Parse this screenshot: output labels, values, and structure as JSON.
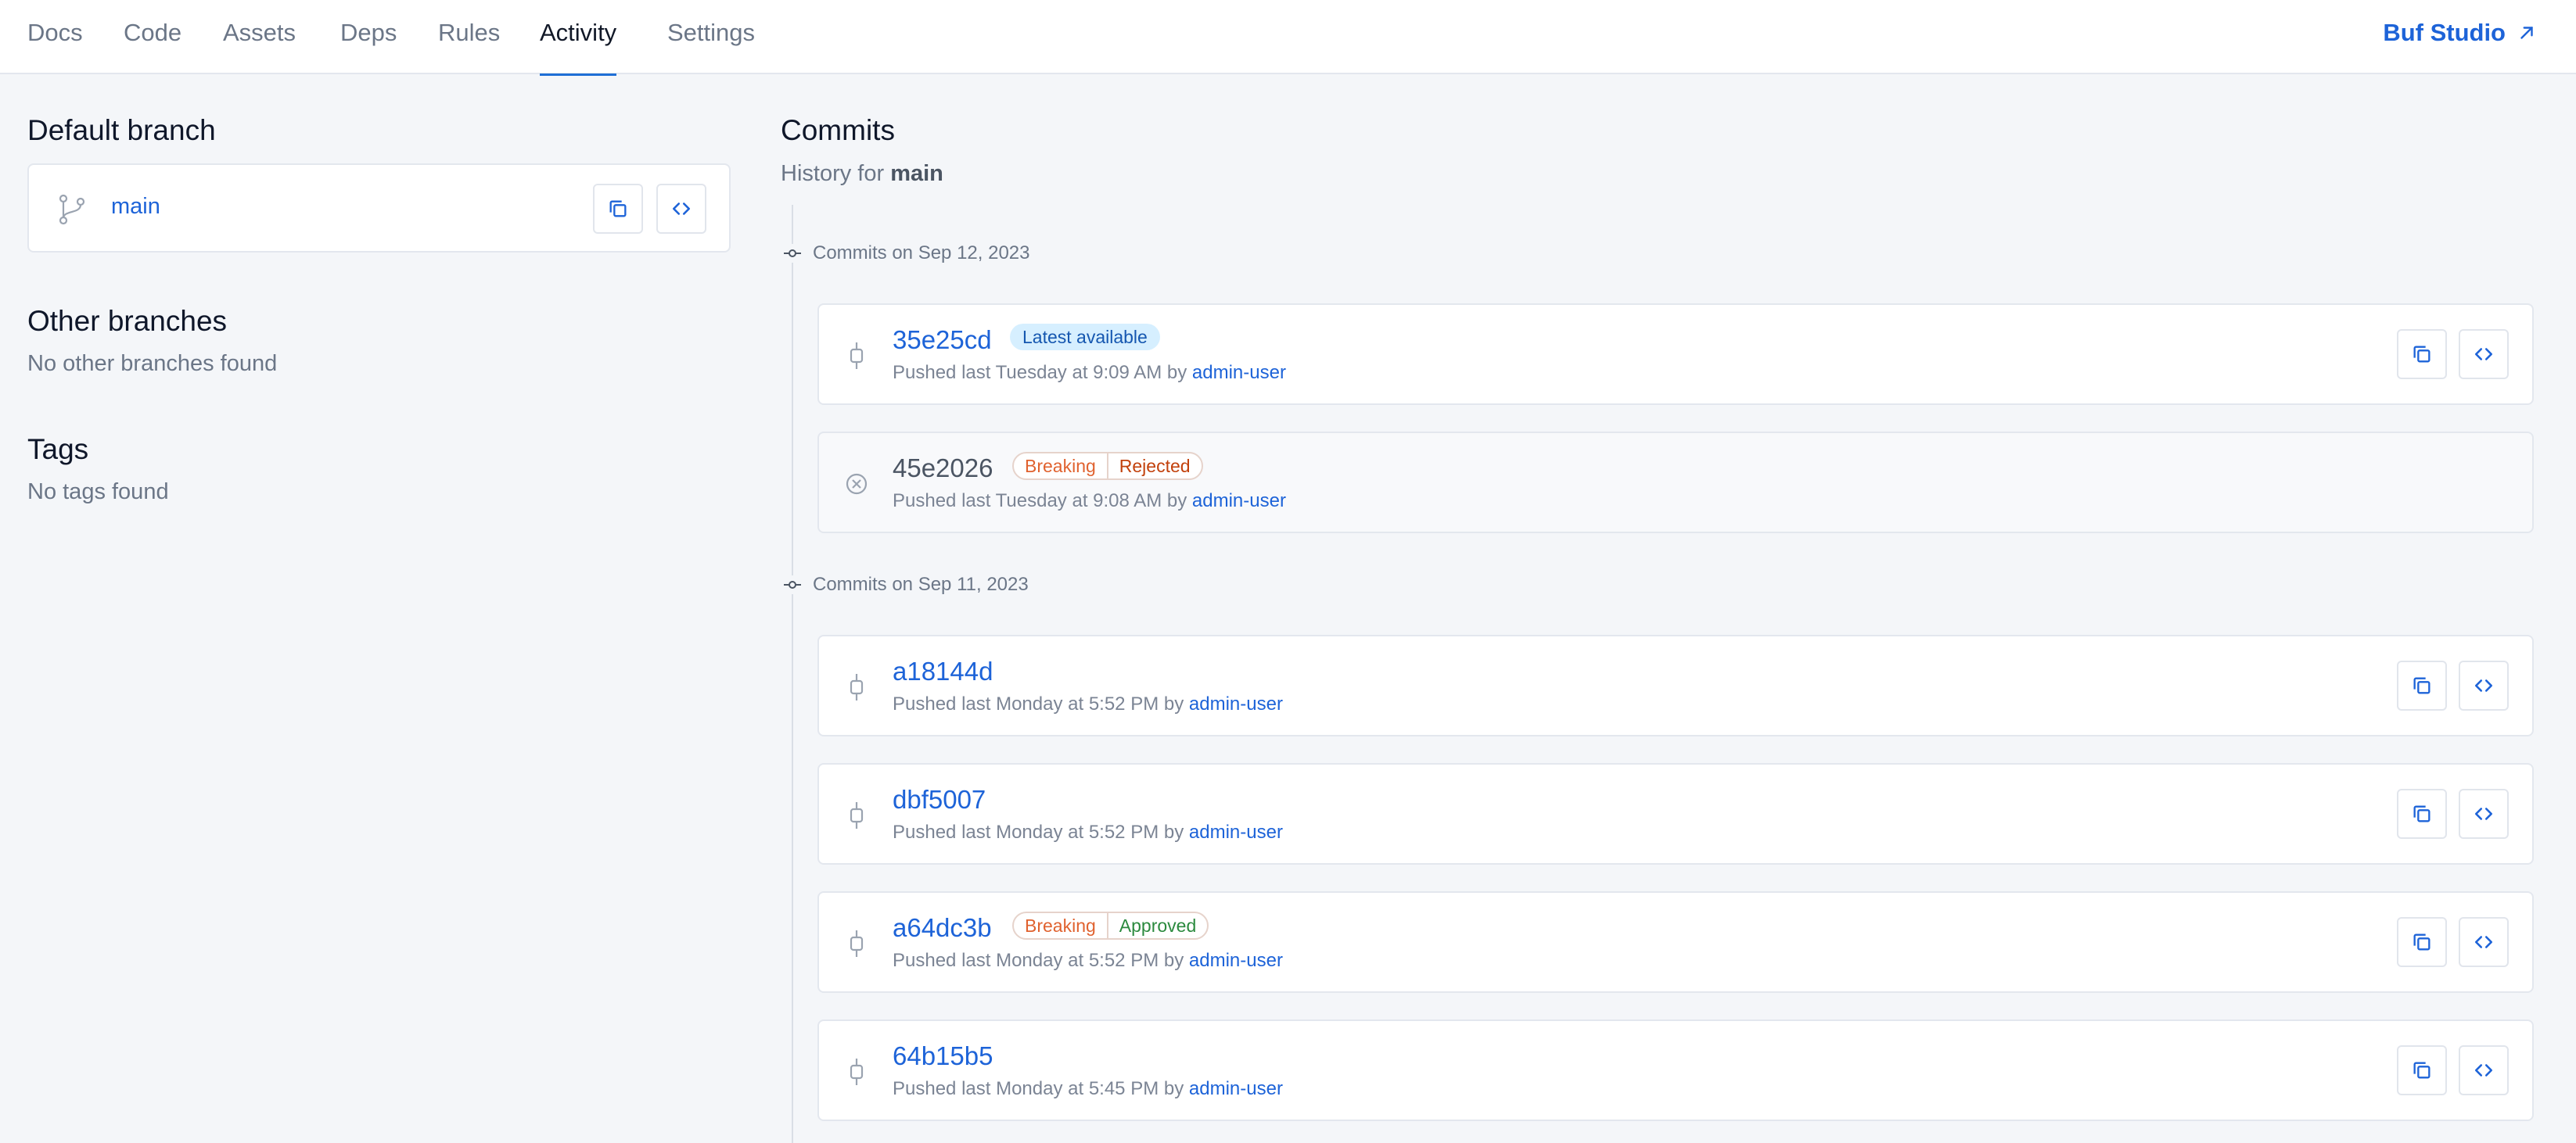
{
  "nav": {
    "tabs": [
      {
        "label": "Docs"
      },
      {
        "label": "Code"
      },
      {
        "label": "Assets"
      },
      {
        "label": "Deps"
      },
      {
        "label": "Rules"
      },
      {
        "label": "Activity",
        "active": true
      },
      {
        "label": "Settings"
      }
    ],
    "studio_link": "Buf Studio",
    "studio_icon": "external-arrow-icon"
  },
  "left": {
    "default_branch_title": "Default branch",
    "default_branch_name": "main",
    "other_branches_title": "Other branches",
    "other_branches_empty": "No other branches found",
    "tags_title": "Tags",
    "tags_empty": "No tags found"
  },
  "commits": {
    "title": "Commits",
    "history_prefix": "History for",
    "history_branch": "main",
    "groups": [
      {
        "date_label": "Commits on Sep 12, 2023",
        "items": [
          {
            "hash": "35e25cd",
            "pushed": "Pushed last Tuesday at 9:09 AM by",
            "user": "admin-user",
            "badge_latest": "Latest available"
          },
          {
            "hash": "45e2026",
            "pushed": "Pushed last Tuesday at 9:08 AM by",
            "user": "admin-user",
            "badge_breaking": "Breaking",
            "badge_status": "Rejected"
          }
        ]
      },
      {
        "date_label": "Commits on Sep 11, 2023",
        "items": [
          {
            "hash": "a18144d",
            "pushed": "Pushed last Monday at 5:52 PM by",
            "user": "admin-user"
          },
          {
            "hash": "dbf5007",
            "pushed": "Pushed last Monday at 5:52 PM by",
            "user": "admin-user"
          },
          {
            "hash": "a64dc3b",
            "pushed": "Pushed last Monday at 5:52 PM by",
            "user": "admin-user",
            "badge_breaking": "Breaking",
            "badge_status": "Approved"
          },
          {
            "hash": "64b15b5",
            "pushed": "Pushed last Monday at 5:45 PM by",
            "user": "admin-user"
          }
        ]
      }
    ]
  },
  "colors": {
    "accent": "#1d63d8",
    "breaking": "#e0622f",
    "rejected": "#c2410c",
    "approved": "#2b8a3e",
    "latest_bg": "#d6efff"
  }
}
